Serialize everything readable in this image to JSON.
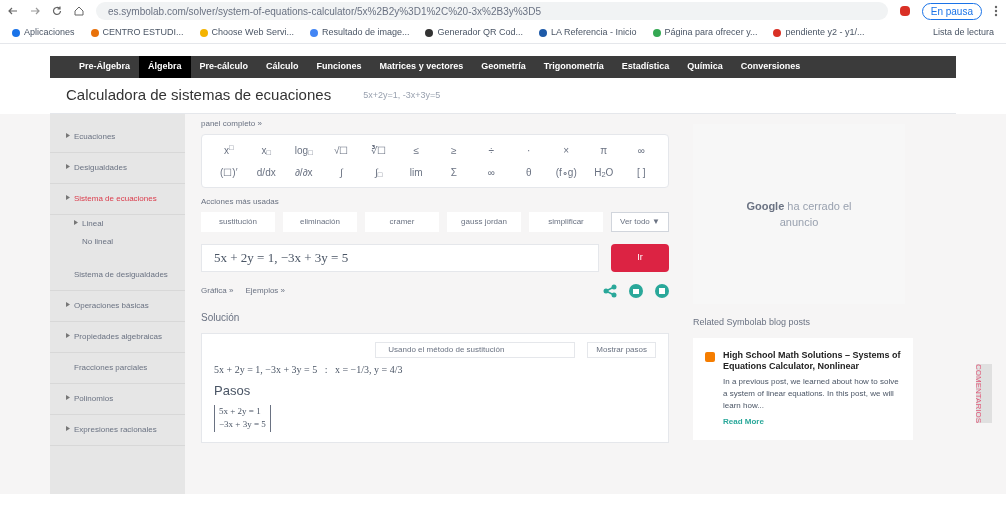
{
  "browser": {
    "url": "es.symbolab.com/solver/system-of-equations-calculator/5x%2B2y%3D1%2C%20-3x%2B3y%3D5",
    "profile": "En pausa",
    "bookmarks": [
      {
        "label": "Aplicaciones",
        "color": "#1a73e8"
      },
      {
        "label": "CENTRO ESTUDI...",
        "color": "#e8710a"
      },
      {
        "label": "Choose Web Servi...",
        "color": "#f4b400"
      },
      {
        "label": "Resultado de image...",
        "color": "#4285f4"
      },
      {
        "label": "Generador QR Cod...",
        "color": "#333333"
      },
      {
        "label": "LA Referencia - Inicio",
        "color": "#1e5aa8"
      },
      {
        "label": "Página para ofrecer y...",
        "color": "#34a853"
      },
      {
        "label": "pendiente y2 - y1/...",
        "color": "#d93025"
      }
    ],
    "reading_list": "Lista de lectura"
  },
  "nav": [
    {
      "label": "Pre-Álgebra",
      "selected": false
    },
    {
      "label": "Álgebra",
      "selected": true
    },
    {
      "label": "Pre-cálculo",
      "selected": false
    },
    {
      "label": "Cálculo",
      "selected": false
    },
    {
      "label": "Funciones",
      "selected": false
    },
    {
      "label": "Matrices y vectores",
      "selected": false
    },
    {
      "label": "Geometría",
      "selected": false
    },
    {
      "label": "Trigonometría",
      "selected": false
    },
    {
      "label": "Estadística",
      "selected": false
    },
    {
      "label": "Química",
      "selected": false
    },
    {
      "label": "Conversiones",
      "selected": false
    }
  ],
  "page_title": "Calculadora de sistemas de ecuaciones",
  "page_subtitle": "5x+2y=1, -3x+3y=5",
  "sidebar": [
    {
      "label": "Ecuaciones",
      "expandable": true,
      "selected": false
    },
    {
      "label": "Desigualdades",
      "expandable": true,
      "selected": false
    },
    {
      "label": "Sistema de ecuaciones",
      "expandable": true,
      "selected": true,
      "children": [
        {
          "label": "Lineal",
          "expandable": true,
          "selected": false
        },
        {
          "label": "No lineal",
          "expandable": false,
          "selected": false
        }
      ]
    },
    {
      "label": "Sistema de desigualdades",
      "expandable": false,
      "selected": false
    },
    {
      "label": "Operaciones básicas",
      "expandable": true,
      "selected": false
    },
    {
      "label": "Propiedades algebraicas",
      "expandable": true,
      "selected": false
    },
    {
      "label": "Fracciones parciales",
      "expandable": false,
      "selected": false
    },
    {
      "label": "Polinomios",
      "expandable": true,
      "selected": false
    },
    {
      "label": "Expresiones racionales",
      "expandable": true,
      "selected": false
    }
  ],
  "panel_link": "panel completo »",
  "keypad": [
    [
      "x$^{□}$",
      "x$_{□}$",
      "log$_{□}$",
      "√☐",
      "∛☐",
      "≤",
      "≥",
      "÷",
      "·",
      "×",
      "π",
      "∞"
    ],
    [
      "(☐)′",
      "d/dx",
      "∂/∂x",
      "∫",
      "∫$_{□}$",
      "lim",
      "Σ",
      "∞",
      "θ",
      "(f∘g)",
      "H$_{2}$O",
      "[ ]"
    ]
  ],
  "actions_label": "Acciones más usadas",
  "actions": [
    "sustitución",
    "eliminación",
    "cramer",
    "gauss jordan",
    "simplificar"
  ],
  "see_all": "Ver todo ▼",
  "input": {
    "value": "5x + 2y = 1, −3x + 3y = 5"
  },
  "go": "Ir",
  "links": [
    "Gráfica »",
    "Ejemplos »"
  ],
  "solution_label": "Solución",
  "method": "Usando el método de sustitución",
  "show_steps": "Mostrar pasos",
  "result": "5x + 2y = 1, −3x + 3y = 5   :   x = −1/3, y = 4/3",
  "steps_label": "Pasos",
  "steps_matrix": [
    "5x + 2y = 1",
    "−3x + 3y = 5"
  ],
  "ad": {
    "brand": "Google",
    "text": "ha cerrado el anuncio"
  },
  "blog": {
    "heading": "Related Symbolab blog posts",
    "title": "High School Math Solutions – Systems of Equations Calculator, Nonlinear",
    "body": "In a previous post, we learned about how to solve a system of linear equations. In this post, we will learn how...",
    "link": "Read More"
  },
  "feedback": "COMENTARIOS"
}
